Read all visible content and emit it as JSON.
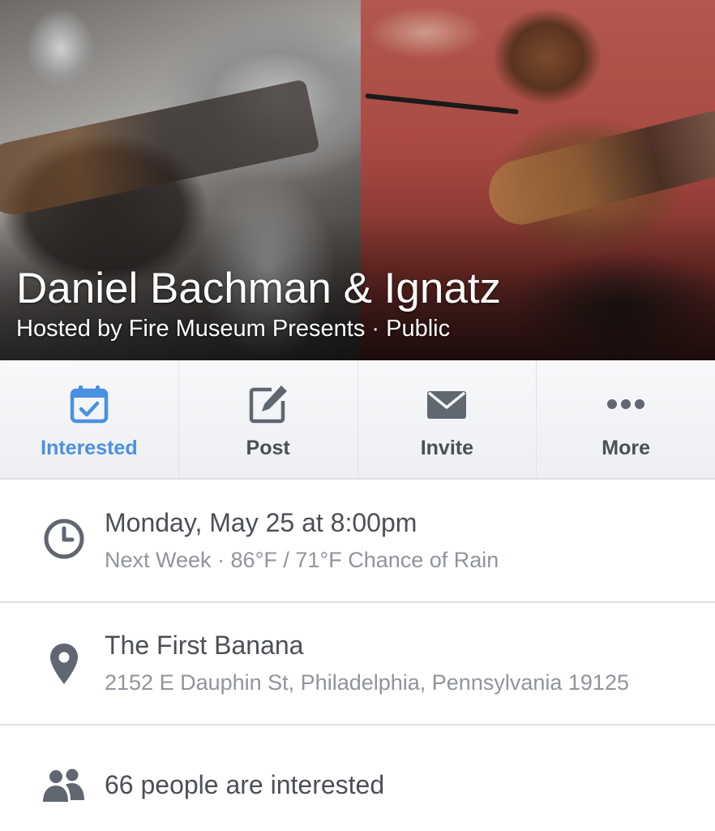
{
  "event": {
    "title": "Daniel Bachman & Ignatz",
    "subtitle": "Hosted by Fire Museum Presents · Public"
  },
  "actions": [
    {
      "label": "Interested",
      "icon": "calendar-check-icon",
      "active": true
    },
    {
      "label": "Post",
      "icon": "edit-icon",
      "active": false
    },
    {
      "label": "Invite",
      "icon": "envelope-icon",
      "active": false
    },
    {
      "label": "More",
      "icon": "more-dots-icon",
      "active": false
    }
  ],
  "details": {
    "time": {
      "icon": "clock-icon",
      "main": "Monday, May 25 at 8:00pm",
      "sub": "Next Week · 86°F / 71°F Chance of Rain"
    },
    "location": {
      "icon": "location-pin-icon",
      "main": "The First Banana",
      "sub": "2152 E Dauphin St, Philadelphia, Pennsylvania 19125"
    },
    "attendance": {
      "icon": "people-icon",
      "main": "66 people are interested"
    }
  },
  "colors": {
    "accent": "#4a90e2",
    "text_primary": "#4b4f56",
    "text_secondary": "#90949c",
    "divider": "#dddfe2"
  }
}
